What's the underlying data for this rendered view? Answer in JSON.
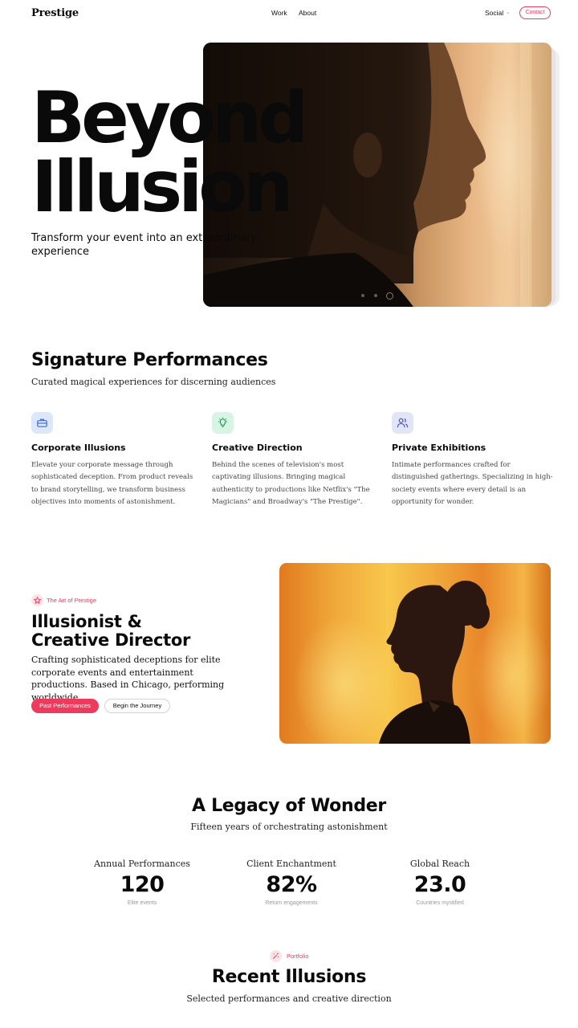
{
  "nav": {
    "logo": "Prestige",
    "links": [
      "Work",
      "About"
    ],
    "social_label": "Social",
    "contact_label": "Contact"
  },
  "hero": {
    "title_line1": "Beyond",
    "title_line2": "Illusion",
    "subtitle": "Transform your event into an extraordinary experience",
    "carousel_slide_count": 3,
    "carousel_active_index": 2
  },
  "signature": {
    "title": "Signature Performances",
    "subtitle": "Curated magical experiences for discerning audiences",
    "cards": [
      {
        "icon": "briefcase-icon",
        "icon_color": "#3b6fd8",
        "icon_bg": "#dde7fb",
        "title": "Corporate Illusions",
        "body": "Elevate your corporate message through sophisticated deception. From product reveals to brand storytelling, we transform business objectives into moments of astonishment."
      },
      {
        "icon": "lightbulb-icon",
        "icon_color": "#1f9e5a",
        "icon_bg": "#d8f4e4",
        "title": "Creative Direction",
        "body": "Behind the scenes of television's most captivating illusions. Bringing magical authenticity to productions like Netflix's \"The Magicians\" and Broadway's \"The Prestige\"."
      },
      {
        "icon": "users-icon",
        "icon_color": "#4b55c8",
        "icon_bg": "#e2e4f8",
        "title": "Private Exhibitions",
        "body": "Intimate performances crafted for distinguished gatherings. Specializing in high-society events where every detail is an opportunity for wonder."
      }
    ]
  },
  "about": {
    "badge": "The Art of Prestige",
    "title_line1": "Illusionist &",
    "title_line2": "Creative Director",
    "text": "Crafting sophisticated deceptions for elite corporate events and entertainment productions. Based in Chicago, performing worldwide.",
    "primary_button": "Past Performances",
    "secondary_button": "Begin the Journey"
  },
  "legacy": {
    "title": "A Legacy of Wonder",
    "subtitle": "Fifteen years of orchestrating astonishment",
    "stats": [
      {
        "label": "Annual Performances",
        "value": "120",
        "note": "Elite events"
      },
      {
        "label": "Client Enchantment",
        "value": "82%",
        "note": "Return engagements"
      },
      {
        "label": "Global Reach",
        "value": "23.0",
        "note": "Countries mystified"
      }
    ]
  },
  "portfolio": {
    "badge": "Portfolio",
    "title": "Recent Illusions",
    "subtitle": "Selected performances and creative direction"
  },
  "colors": {
    "accent": "#ee3a5c",
    "text": "#0a0a0a"
  }
}
